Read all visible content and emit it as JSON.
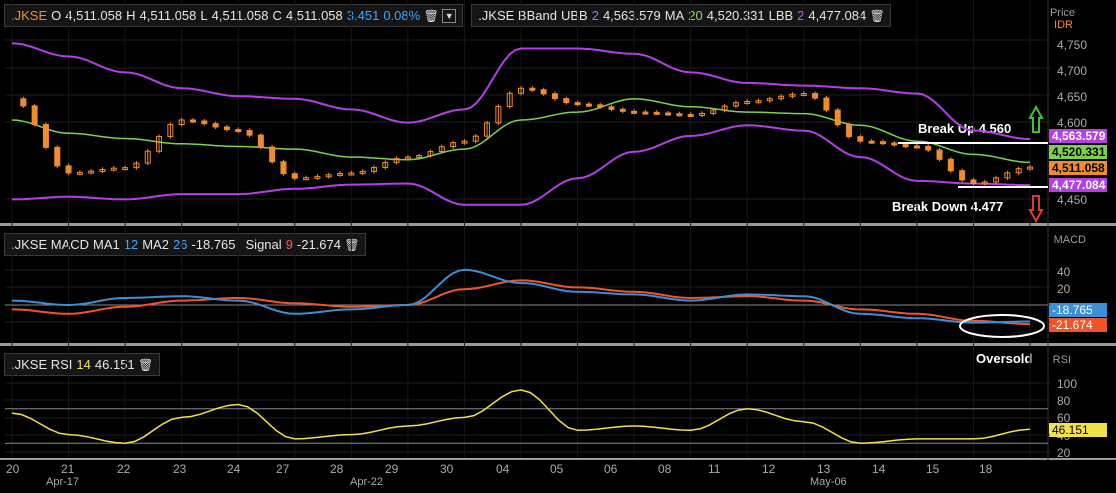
{
  "price_pane": {
    "symbol": ".JKSE",
    "open_label": "O",
    "open": "4,511.058",
    "high_label": "H",
    "high": "4,511.058",
    "low_label": "L",
    "low": "4,511.058",
    "close_label": "C",
    "close": "4,511.058",
    "change": "3.451",
    "change_pct": "0.08%",
    "axis_title": "Price",
    "axis_unit": "IDR",
    "ticks": [
      "4,750",
      "4,700",
      "4,650",
      "4,600",
      "4,450"
    ],
    "tags": {
      "ubb": "4,563.579",
      "ma": "4,520.331",
      "last": "4,511.058",
      "lbb": "4,477.084"
    }
  },
  "bband_legend": {
    "symbol": ".JKSE BBand",
    "ubb_label": "UBB",
    "ubb_period": "2",
    "ubb_value": "4,563.579",
    "ma_label": "MA",
    "ma_period": "20",
    "ma_value": "4,520.331",
    "lbb_label": "LBB",
    "lbb_period": "2",
    "lbb_value": "4,477.084"
  },
  "annotations": {
    "break_up": "Break Up 4.560",
    "break_down": "Break Down 4.477",
    "oversold": "Oversold"
  },
  "macd_pane": {
    "symbol": ".JKSE MACD",
    "ma1_label": "MA1",
    "ma1": "12",
    "ma2_label": "MA2",
    "ma2": "26",
    "macd_value": "-18.765",
    "signal_label": "Signal",
    "signal_period": "9",
    "signal_value": "-21.674",
    "axis_title": "MACD",
    "ticks": [
      "40",
      "20"
    ],
    "tags": {
      "macd": "-18.765",
      "signal": "-21.674"
    }
  },
  "rsi_pane": {
    "symbol": ".JKSE RSI",
    "period": "14",
    "value": "46.151",
    "axis_title": "RSI",
    "ticks": [
      "100",
      "80",
      "60",
      "40",
      "20"
    ],
    "tag": "46.151"
  },
  "x_axis": {
    "days": [
      "20",
      "21",
      "22",
      "23",
      "24",
      "27",
      "28",
      "29",
      "30",
      "04",
      "05",
      "06",
      "08",
      "11",
      "12",
      "13",
      "14",
      "15",
      "18"
    ],
    "months": [
      "Apr-17",
      "Apr-22",
      "May-06"
    ]
  },
  "colors": {
    "candle": "#f28c2a",
    "bb_band": "#b53ee6",
    "ma": "#7cd34a",
    "macd": "#3a8fd6",
    "signal": "#f0552a",
    "rsi": "#f2e14a",
    "up_arrow": "#3cc43c",
    "down_arrow": "#e03a2a"
  },
  "chart_data": {
    "type": "line",
    "title": "",
    "x": [
      "Apr-20",
      "Apr-21",
      "Apr-22",
      "Apr-23",
      "Apr-24",
      "Apr-27",
      "Apr-28",
      "Apr-29",
      "Apr-30",
      "May-04",
      "May-05",
      "May-06",
      "May-08",
      "May-11",
      "May-12",
      "May-13",
      "May-14",
      "May-15",
      "May-18"
    ],
    "series": [
      {
        "name": "UBB",
        "values": [
          4745,
          4720,
          4690,
          4660,
          4645,
          4640,
          4620,
          4595,
          4620,
          4735,
          4735,
          4725,
          4690,
          4670,
          4665,
          4660,
          4650,
          4580,
          4564
        ]
      },
      {
        "name": "MA",
        "values": [
          4600,
          4575,
          4565,
          4555,
          4550,
          4545,
          4530,
          4525,
          4545,
          4600,
          4615,
          4640,
          4625,
          4615,
          4612,
          4590,
          4560,
          4535,
          4520
        ]
      },
      {
        "name": "LBB",
        "values": [
          4450,
          4455,
          4450,
          4460,
          4460,
          4470,
          4478,
          4480,
          4440,
          4440,
          4490,
          4540,
          4570,
          4590,
          4580,
          4530,
          4485,
          4480,
          4477
        ]
      },
      {
        "name": "Close",
        "values": [
          4640,
          4500,
          4510,
          4600,
          4580,
          4490,
          4500,
          4530,
          4560,
          4660,
          4630,
          4615,
          4610,
          4635,
          4650,
          4560,
          4550,
          4480,
          4511
        ]
      }
    ],
    "ylim": [
      4430,
      4770
    ],
    "macd": {
      "macd": [
        5,
        0,
        8,
        10,
        5,
        -10,
        -5,
        0,
        40,
        25,
        15,
        12,
        5,
        12,
        10,
        -10,
        -15,
        -20,
        -18.765
      ],
      "signal": [
        -5,
        -10,
        -2,
        5,
        8,
        2,
        -2,
        0,
        18,
        28,
        20,
        15,
        8,
        10,
        5,
        -5,
        -10,
        -18,
        -21.674
      ]
    },
    "rsi": [
      65,
      40,
      30,
      60,
      75,
      35,
      40,
      50,
      60,
      92,
      45,
      50,
      45,
      70,
      55,
      30,
      35,
      35,
      46.151
    ]
  }
}
